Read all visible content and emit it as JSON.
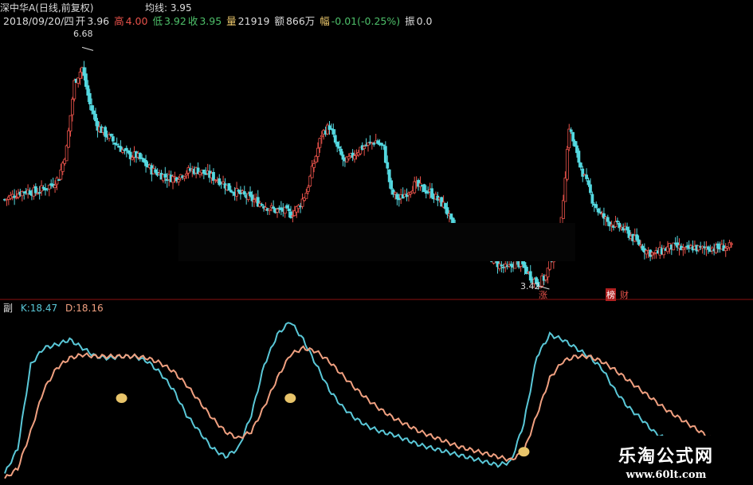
{
  "header": {
    "title": "深中华A(日线,前复权)",
    "ma_label": "均线: 3.95",
    "date": "2018/09/20/四",
    "open_label": "开",
    "open": "3.96",
    "high_label": "高",
    "high": "4.00",
    "low_label": "低",
    "low": "3.92",
    "close_label": "收",
    "close": "3.95",
    "volume_label": "量",
    "volume": "21919",
    "amount_label": "额",
    "amount": "866万",
    "change_label": "幅",
    "change": "-0.01(-0.25%)",
    "amplitude_label": "振",
    "amplitude": "0.0"
  },
  "price_annotations": {
    "high_mark": "6.68",
    "low_mark": "3.42",
    "markers": [
      "涨",
      "榜",
      "财"
    ]
  },
  "indicator": {
    "panel_label": "副",
    "k_label": "K:",
    "k_value": "18.47",
    "d_label": "D:",
    "d_value": "18.16"
  },
  "watermark": {
    "line1": "乐淘公式网",
    "line2": "www.60lt.com"
  },
  "colors": {
    "background": "#000000",
    "up_candle": "#e8524a",
    "down_candle": "#54d8e0",
    "k_line": "#5ac8d8",
    "d_line": "#f0a080",
    "divider": "#8b1010",
    "signal_dot": "#e8c46a"
  },
  "chart_data": [
    {
      "type": "candlestick",
      "title": "",
      "ylim": [
        3.3,
        7.0
      ],
      "high": 6.68,
      "low": 3.42,
      "close_path": [
        4.6,
        4.65,
        4.7,
        4.72,
        4.7,
        4.75,
        4.8,
        4.9,
        5.3,
        6.2,
        6.4,
        5.9,
        5.6,
        5.5,
        5.4,
        5.3,
        5.2,
        5.2,
        5.1,
        5.0,
        4.95,
        4.9,
        4.9,
        4.95,
        5.0,
        5.0,
        4.95,
        4.9,
        4.85,
        4.75,
        4.7,
        4.65,
        4.6,
        4.55,
        4.5,
        4.45,
        4.45,
        4.4,
        4.5,
        4.7,
        5.1,
        5.5,
        5.6,
        5.3,
        5.1,
        5.2,
        5.3,
        5.35,
        5.4,
        5.3,
        4.7,
        4.6,
        4.7,
        4.8,
        4.75,
        4.7,
        4.6,
        4.5,
        4.2,
        4.1,
        4.05,
        4.0,
        3.9,
        3.8,
        3.7,
        3.65,
        3.75,
        3.7,
        3.55,
        3.45,
        3.55,
        3.9,
        4.3,
        5.6,
        5.2,
        4.9,
        4.6,
        4.4,
        4.3,
        4.25,
        4.2,
        4.1,
        4.0,
        3.9,
        3.85,
        3.9,
        3.95,
        3.95,
        3.9,
        3.95,
        3.92,
        3.95,
        3.93,
        3.95,
        3.95
      ]
    },
    {
      "type": "line",
      "title": "",
      "ylim": [
        0,
        100
      ],
      "series": [
        {
          "name": "K",
          "values": [
            5,
            20,
            70,
            80,
            82,
            85,
            80,
            75,
            74,
            75,
            75,
            72,
            65,
            55,
            40,
            30,
            20,
            15,
            20,
            40,
            70,
            88,
            96,
            85,
            70,
            55,
            45,
            38,
            33,
            30,
            28,
            25,
            22,
            20,
            18,
            16,
            14,
            12,
            10,
            12,
            35,
            75,
            88,
            85,
            80,
            75,
            68,
            55,
            45,
            38,
            30,
            25,
            22,
            20,
            18,
            18,
            18.47
          ]
        },
        {
          "name": "D",
          "values": [
            2,
            8,
            30,
            55,
            68,
            74,
            76,
            75,
            75,
            75,
            75,
            74,
            71,
            66,
            58,
            48,
            38,
            30,
            26,
            30,
            45,
            62,
            76,
            80,
            78,
            72,
            64,
            56,
            49,
            43,
            38,
            34,
            30,
            27,
            24,
            21,
            19,
            17,
            15,
            13,
            18,
            40,
            62,
            72,
            75,
            75,
            72,
            67,
            61,
            55,
            49,
            43,
            38,
            33,
            28,
            22,
            18.16
          ]
        }
      ],
      "signals": [
        9,
        22,
        40,
        56
      ]
    }
  ]
}
